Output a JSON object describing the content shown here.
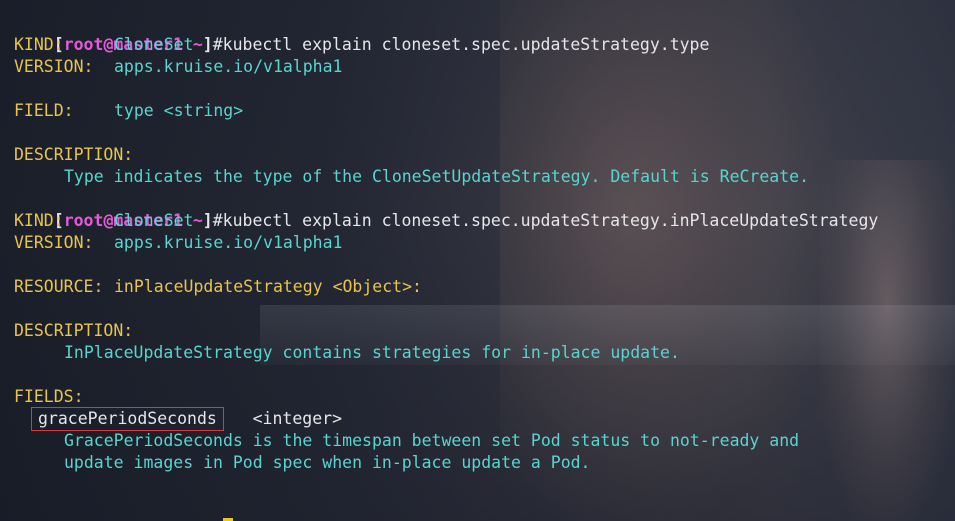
{
  "prompt": {
    "user": "root",
    "at": "@",
    "host": "master1",
    "dir": "~",
    "symbol": "#"
  },
  "blocks": [
    {
      "command": "kubectl explain cloneset.spec.updateStrategy.type",
      "kind_key": "KIND:",
      "kind_value": "CloneSet",
      "version_key": "VERSION:",
      "version_value": "apps.kruise.io/v1alpha1",
      "field_key": "FIELD:",
      "field_value": "type <string>",
      "description_key": "DESCRIPTION:",
      "description": "Type indicates the type of the CloneSetUpdateStrategy. Default is ReCreate."
    },
    {
      "command": "kubectl explain cloneset.spec.updateStrategy.inPlaceUpdateStrategy",
      "kind_key": "KIND:",
      "kind_value": "CloneSet",
      "version_key": "VERSION:",
      "version_value": "apps.kruise.io/v1alpha1",
      "resource_key": "RESOURCE:",
      "resource_value": "inPlaceUpdateStrategy",
      "resource_type": "<Object>:",
      "description_key": "DESCRIPTION:",
      "description": "InPlaceUpdateStrategy contains strategies for in-place update.",
      "fields_key": "FIELDS:",
      "field_name": "gracePeriodSeconds",
      "field_type": "<integer>",
      "field_desc_1": "GracePeriodSeconds is the timespan between set Pod status to not-ready and",
      "field_desc_2": "update images in Pod spec when in-place update a Pod."
    }
  ],
  "colors": {
    "background": "#2c2f3a",
    "prompt_user": "#e05bd6",
    "text": "#e6e6ea",
    "value": "#5ad4d0",
    "key": "#e8c44a",
    "highlight_border": "#d83a3a",
    "cursor": "#f0c419"
  }
}
